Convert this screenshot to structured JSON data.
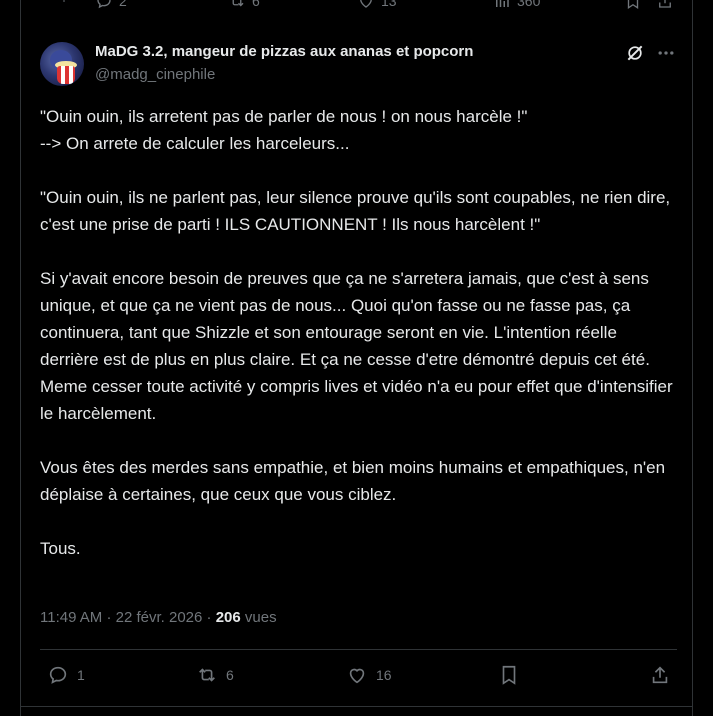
{
  "previous_post": {
    "replies": "2",
    "reposts": "6",
    "likes": "13",
    "views": "360"
  },
  "author": {
    "display_name": "MaDG 3.2, mangeur de pizzas aux ananas et popcorn",
    "handle": "@madg_cinephile"
  },
  "post": {
    "paragraphs": [
      "\"Ouin ouin, ils arretent pas de parler de nous ! on nous harcèle !\"\n--> On arrete de calculer les harceleurs...",
      "\"Ouin ouin, ils ne parlent pas, leur silence prouve qu'ils sont coupables, ne rien dire, c'est une prise de parti ! ILS CAUTIONNENT ! Ils nous harcèlent !\"",
      "Si y'avait encore besoin de preuves que ça ne s'arretera jamais, que c'est à sens unique, et que ça ne vient pas de nous... Quoi qu'on fasse ou ne fasse pas, ça continuera, tant que Shizzle et son entourage seront en vie. L'intention réelle derrière est de plus en plus claire. Et ça ne cesse d'etre démontré depuis cet été. Meme cesser toute activité y compris lives et vidéo n'a eu pour effet que d'intensifier le harcèlement.",
      "Vous êtes des merdes sans empathie, et bien moins humains et empathiques, n'en déplaise à certaines, que ceux que vous ciblez.",
      "Tous."
    ],
    "time": "11:49 AM",
    "date": "22 févr. 2026",
    "separator": "·",
    "views_count": "206",
    "views_label": "vues"
  },
  "actions": {
    "replies": "1",
    "reposts": "6",
    "likes": "16"
  },
  "icons": [
    "reply-icon",
    "repost-icon",
    "like-icon",
    "views-icon",
    "bookmark-icon",
    "share-icon",
    "grok-icon",
    "more-icon"
  ]
}
